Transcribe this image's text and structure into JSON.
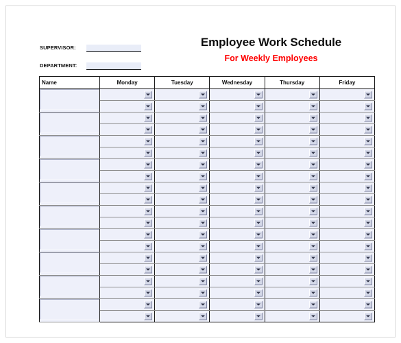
{
  "document": {
    "title_main": "Employee Work Schedule",
    "title_sub": "For Weekly Employees",
    "title_sub_color": "#ff0000"
  },
  "fields": [
    {
      "label": "SUPERVISOR:",
      "value": "",
      "placeholder": ""
    },
    {
      "label": "DEPARTMENT:",
      "value": "",
      "placeholder": ""
    }
  ],
  "table": {
    "columns": [
      "Name",
      "Monday",
      "Tuesday",
      "Wednesday",
      "Thursday",
      "Friday"
    ],
    "employee_row_count": 10,
    "shifts_per_employee": 2,
    "dropdown_icon": "chevron-down-icon",
    "cell_background": "#eef0fa",
    "rows": [
      {
        "name": "",
        "monday": [
          "",
          ""
        ],
        "tuesday": [
          "",
          ""
        ],
        "wednesday": [
          "",
          ""
        ],
        "thursday": [
          "",
          ""
        ],
        "friday": [
          "",
          ""
        ]
      },
      {
        "name": "",
        "monday": [
          "",
          ""
        ],
        "tuesday": [
          "",
          ""
        ],
        "wednesday": [
          "",
          ""
        ],
        "thursday": [
          "",
          ""
        ],
        "friday": [
          "",
          ""
        ]
      },
      {
        "name": "",
        "monday": [
          "",
          ""
        ],
        "tuesday": [
          "",
          ""
        ],
        "wednesday": [
          "",
          ""
        ],
        "thursday": [
          "",
          ""
        ],
        "friday": [
          "",
          ""
        ]
      },
      {
        "name": "",
        "monday": [
          "",
          ""
        ],
        "tuesday": [
          "",
          ""
        ],
        "wednesday": [
          "",
          ""
        ],
        "thursday": [
          "",
          ""
        ],
        "friday": [
          "",
          ""
        ]
      },
      {
        "name": "",
        "monday": [
          "",
          ""
        ],
        "tuesday": [
          "",
          ""
        ],
        "wednesday": [
          "",
          ""
        ],
        "thursday": [
          "",
          ""
        ],
        "friday": [
          "",
          ""
        ]
      },
      {
        "name": "",
        "monday": [
          "",
          ""
        ],
        "tuesday": [
          "",
          ""
        ],
        "wednesday": [
          "",
          ""
        ],
        "thursday": [
          "",
          ""
        ],
        "friday": [
          "",
          ""
        ]
      },
      {
        "name": "",
        "monday": [
          "",
          ""
        ],
        "tuesday": [
          "",
          ""
        ],
        "wednesday": [
          "",
          ""
        ],
        "thursday": [
          "",
          ""
        ],
        "friday": [
          "",
          ""
        ]
      },
      {
        "name": "",
        "monday": [
          "",
          ""
        ],
        "tuesday": [
          "",
          ""
        ],
        "wednesday": [
          "",
          ""
        ],
        "thursday": [
          "",
          ""
        ],
        "friday": [
          "",
          ""
        ]
      },
      {
        "name": "",
        "monday": [
          "",
          ""
        ],
        "tuesday": [
          "",
          ""
        ],
        "wednesday": [
          "",
          ""
        ],
        "thursday": [
          "",
          ""
        ],
        "friday": [
          "",
          ""
        ]
      },
      {
        "name": "",
        "monday": [
          "",
          ""
        ],
        "tuesday": [
          "",
          ""
        ],
        "wednesday": [
          "",
          ""
        ],
        "thursday": [
          "",
          ""
        ],
        "friday": [
          "",
          ""
        ]
      }
    ]
  }
}
